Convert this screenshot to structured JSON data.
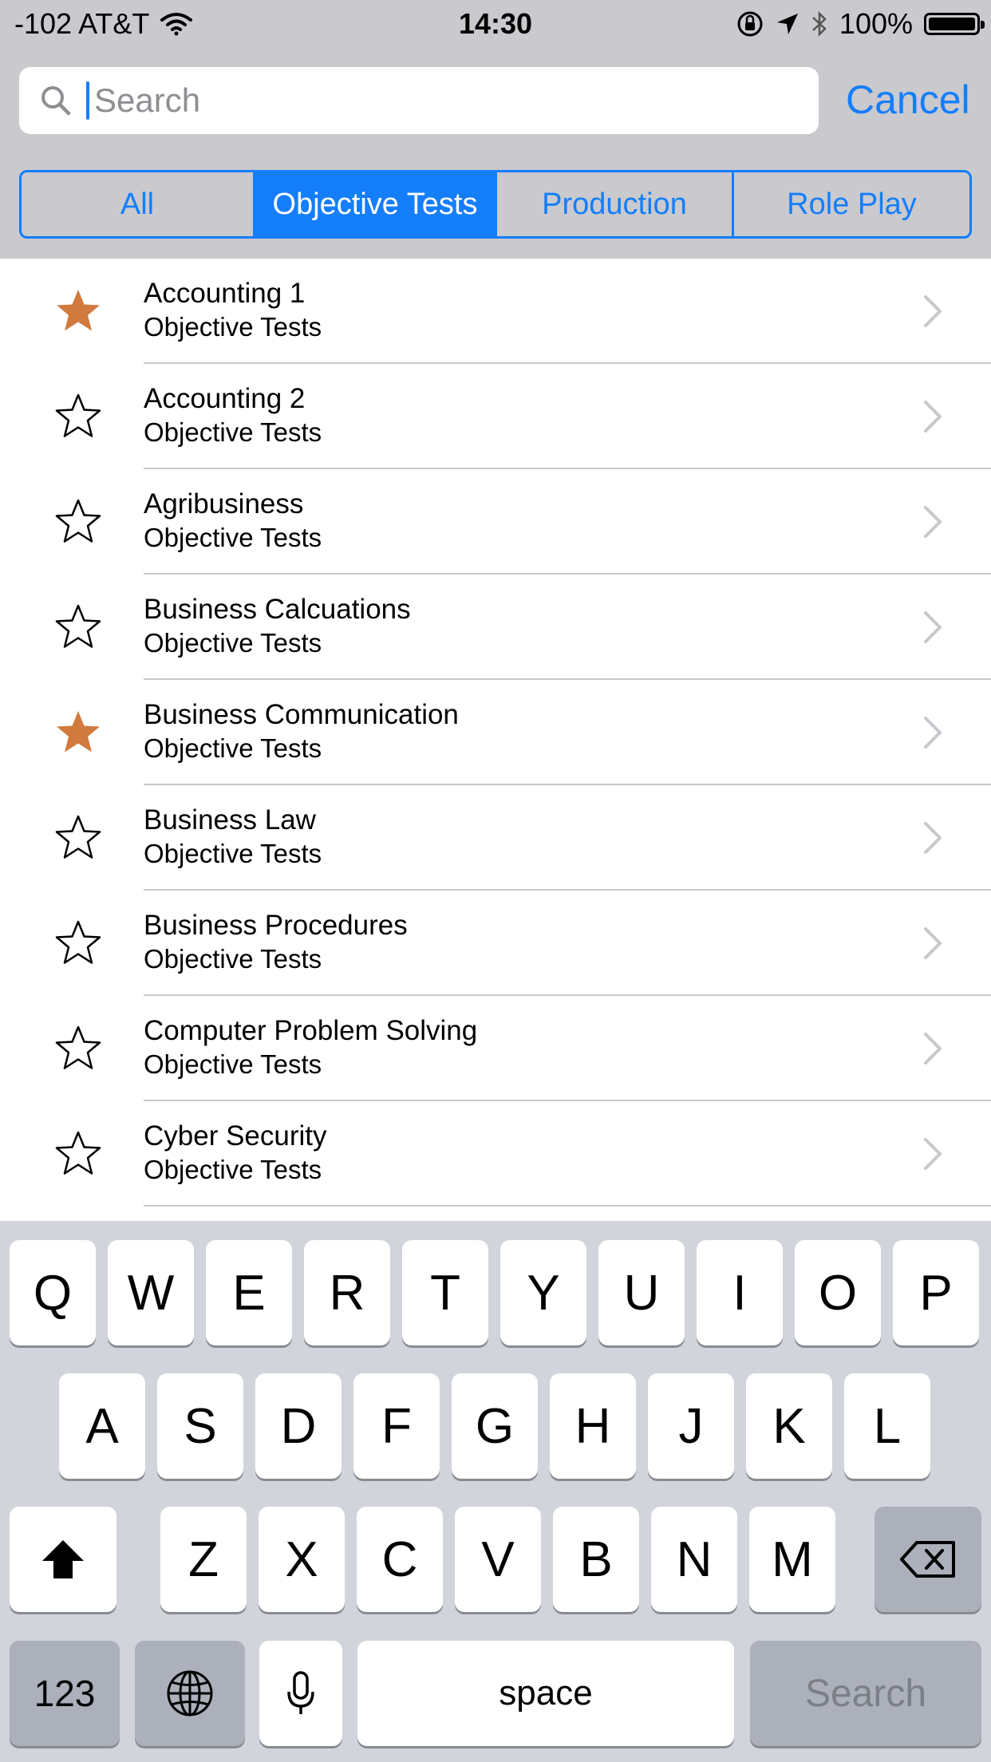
{
  "status_bar": {
    "carrier": "-102 AT&T",
    "time": "14:30",
    "battery": "100%"
  },
  "search": {
    "placeholder": "Search",
    "value": "",
    "cancel_label": "Cancel"
  },
  "segments": [
    {
      "label": "All",
      "active": false
    },
    {
      "label": "Objective Tests",
      "active": true
    },
    {
      "label": "Production",
      "active": false
    },
    {
      "label": "Role Play",
      "active": false
    }
  ],
  "list": [
    {
      "title": "Accounting 1",
      "subtitle": "Objective Tests",
      "favorite": true
    },
    {
      "title": "Accounting 2",
      "subtitle": "Objective Tests",
      "favorite": false
    },
    {
      "title": "Agribusiness",
      "subtitle": "Objective Tests",
      "favorite": false
    },
    {
      "title": "Business Calcuations",
      "subtitle": "Objective Tests",
      "favorite": false
    },
    {
      "title": "Business Communication",
      "subtitle": "Objective Tests",
      "favorite": true
    },
    {
      "title": "Business Law",
      "subtitle": "Objective Tests",
      "favorite": false
    },
    {
      "title": "Business Procedures",
      "subtitle": "Objective Tests",
      "favorite": false
    },
    {
      "title": "Computer Problem Solving",
      "subtitle": "Objective Tests",
      "favorite": false
    },
    {
      "title": "Cyber Security",
      "subtitle": "Objective Tests",
      "favorite": false
    }
  ],
  "keyboard": {
    "row1": [
      "Q",
      "W",
      "E",
      "R",
      "T",
      "Y",
      "U",
      "I",
      "O",
      "P"
    ],
    "row2": [
      "A",
      "S",
      "D",
      "F",
      "G",
      "H",
      "J",
      "K",
      "L"
    ],
    "row3": [
      "Z",
      "X",
      "C",
      "V",
      "B",
      "N",
      "M"
    ],
    "numbers_label": "123",
    "space_label": "space",
    "return_label": "Search"
  },
  "colors": {
    "accent": "#147efb",
    "favorite_star": "#d07a3e",
    "header_bg": "#c9c9ce",
    "keyboard_bg": "#d1d4da"
  }
}
